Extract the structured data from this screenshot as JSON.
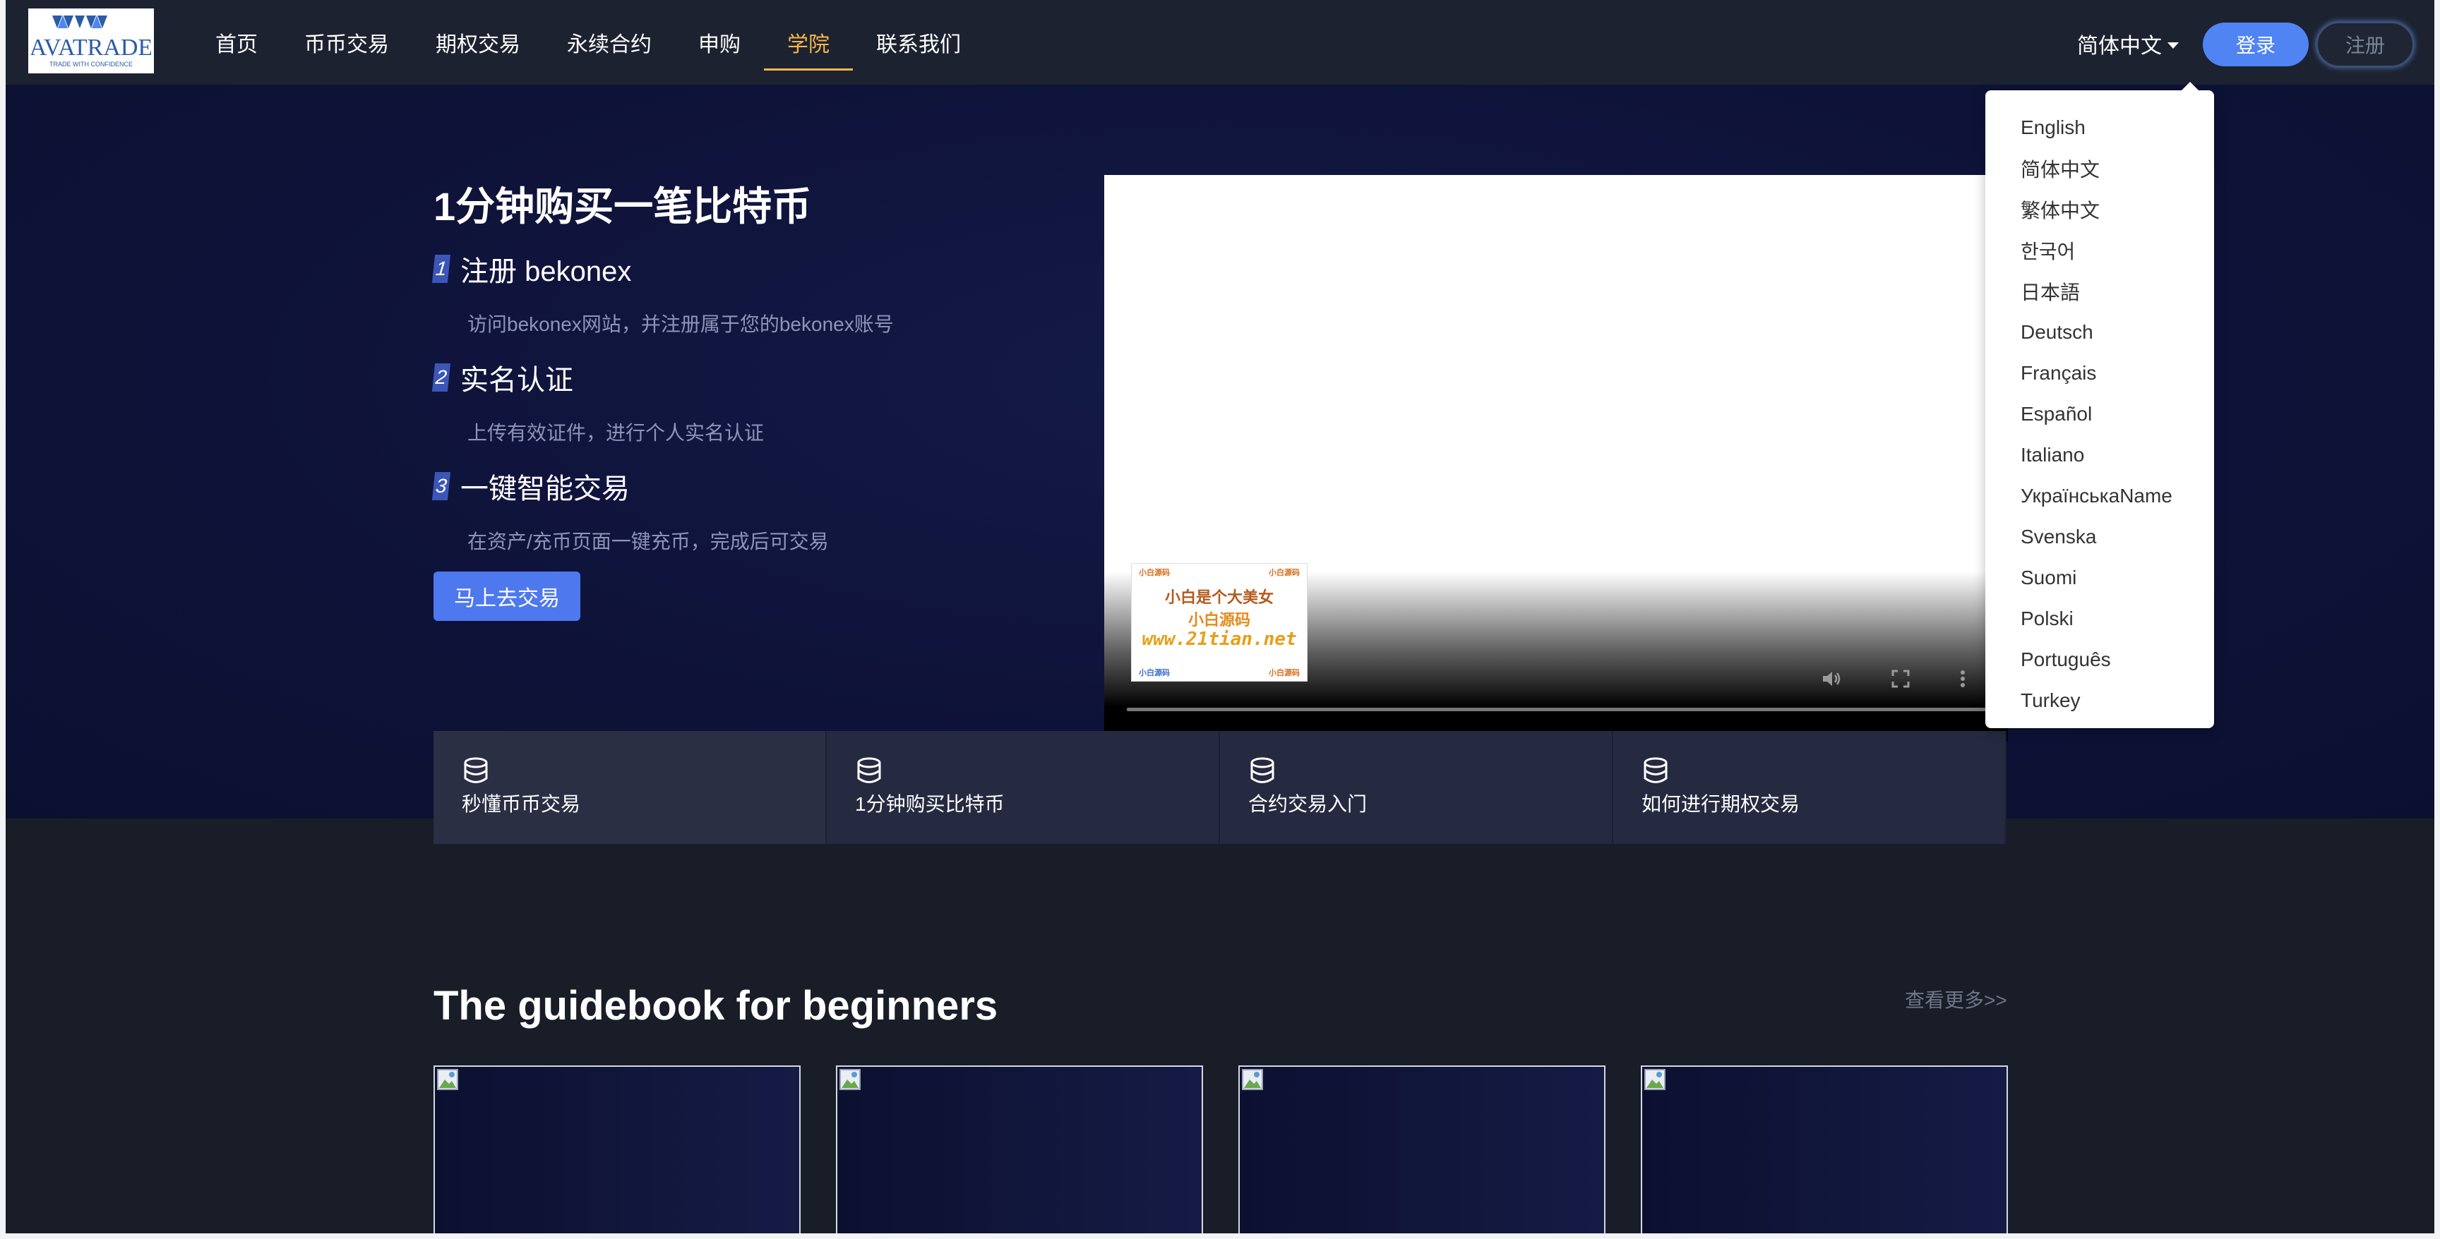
{
  "header": {
    "logo": {
      "main": "AVATRADE",
      "tagline": "TRADE WITH CONFIDENCE"
    },
    "nav": [
      {
        "label": "首页"
      },
      {
        "label": "币币交易"
      },
      {
        "label": "期权交易"
      },
      {
        "label": "永续合约"
      },
      {
        "label": "申购"
      },
      {
        "label": "学院",
        "active": true
      },
      {
        "label": "联系我们"
      }
    ],
    "language": "简体中文",
    "login_label": "登录",
    "register_label": "注册"
  },
  "language_menu": {
    "items": [
      "English",
      "简体中文",
      "繁体中文",
      "한국어",
      "日本語",
      "Deutsch",
      "Français",
      "Español",
      "Italiano",
      "УкраїнськаName",
      "Svenska",
      "Suomi",
      "Polski",
      "Português",
      "Turkey"
    ]
  },
  "hero": {
    "title": "1分钟购买一笔比特币",
    "steps": [
      {
        "num": "1",
        "title": "注册 bekonex",
        "desc": "访问bekonex网站，并注册属于您的bekonex账号"
      },
      {
        "num": "2",
        "title": "实名认证",
        "desc": "上传有效证件，进行个人实名认证"
      },
      {
        "num": "3",
        "title": "一键智能交易",
        "desc": "在资产/充币页面一键充币，完成后可交易"
      }
    ],
    "cta_label": "马上去交易",
    "video": {
      "watermark_line1": "小白是个大美女",
      "watermark_line2": "小白源码",
      "watermark_line3": "www.21tian.net"
    }
  },
  "features": [
    {
      "label": "秒懂币币交易",
      "icon": "database-icon"
    },
    {
      "label": "1分钟购买比特币",
      "icon": "database-icon"
    },
    {
      "label": "合约交易入门",
      "icon": "database-icon"
    },
    {
      "label": "如何进行期权交易",
      "icon": "database-icon"
    }
  ],
  "guide": {
    "title": "The guidebook for beginners",
    "view_more": "查看更多>>",
    "card_count": 4
  },
  "colors": {
    "accent": "#f7b64c",
    "primary": "#4f84f2",
    "hero_bg": "#0e1238"
  }
}
